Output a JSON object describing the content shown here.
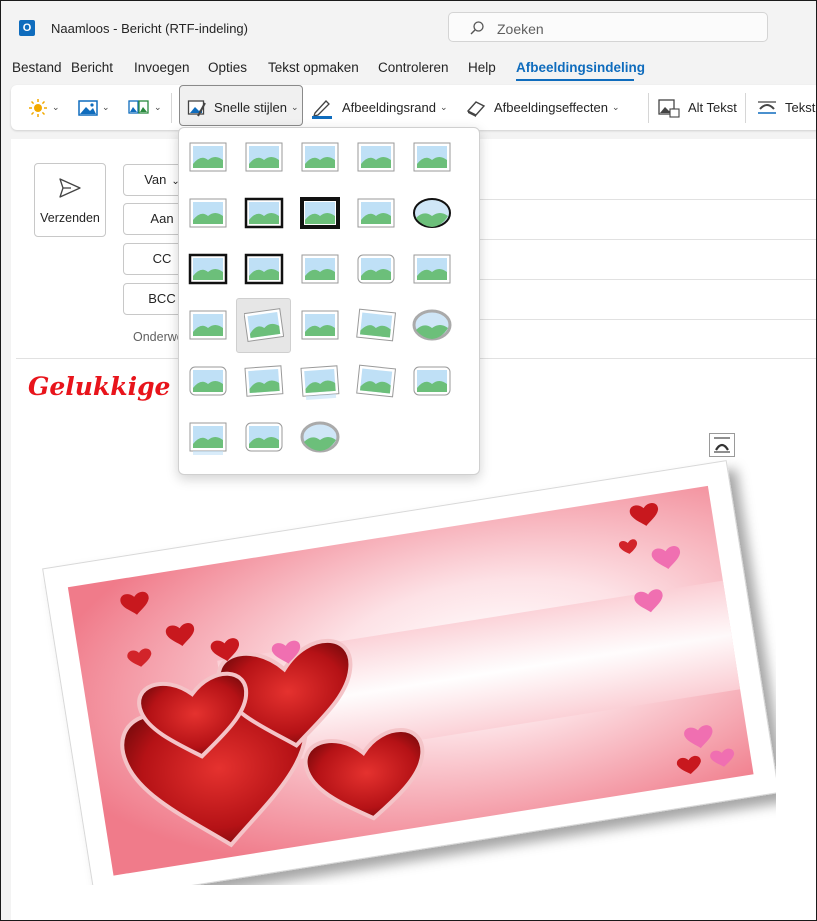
{
  "window": {
    "app_icon_letter": "O",
    "title": "Naamloos  -  Bericht (RTF-indeling)",
    "search_placeholder": "Zoeken"
  },
  "menu": {
    "items": [
      "Bestand",
      "Bericht",
      "Invoegen",
      "Opties",
      "Tekst opmaken",
      "Controleren",
      "Help",
      "Afbeeldingsindeling"
    ],
    "active": "Afbeeldingsindeling"
  },
  "ribbon": {
    "quick_styles": "Snelle stijlen",
    "picture_border": "Afbeeldingsrand",
    "picture_effects": "Afbeeldingseffecten",
    "alt_text": "Alt Tekst",
    "wrap_text": "Tekst"
  },
  "compose": {
    "send": "Verzenden",
    "from": "Van",
    "to": "Aan",
    "cc": "CC",
    "bcc": "BCC",
    "subject_partial": "Onderwe",
    "greeting": "Gelukkige Va"
  },
  "colors": {
    "accent": "#0f6cbd",
    "greeting": "#e8141b"
  },
  "quick_styles_gallery": {
    "rows": 6,
    "columns": 5,
    "count": 28,
    "hovered_index": 16
  }
}
